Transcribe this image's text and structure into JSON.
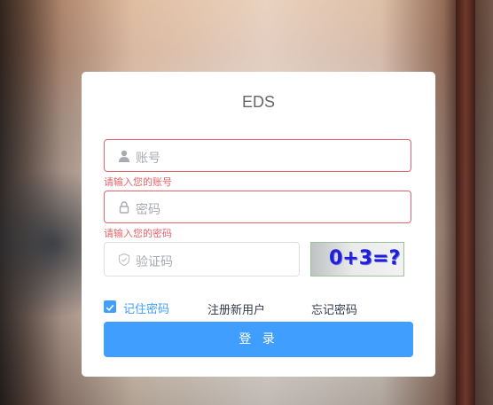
{
  "title": "EDS",
  "account": {
    "placeholder": "账号",
    "error": "请输入您的账号"
  },
  "password": {
    "placeholder": "密码",
    "error": "请输入您的密码"
  },
  "captcha": {
    "placeholder": "验证码",
    "image_text": "0+3=?"
  },
  "remember": {
    "label": "记住密码",
    "checked": true
  },
  "links": {
    "register": "注册新用户",
    "forgot": "忘记密码"
  },
  "login_button": "登 录",
  "colors": {
    "primary": "#409eff",
    "error": "#e2636b"
  }
}
